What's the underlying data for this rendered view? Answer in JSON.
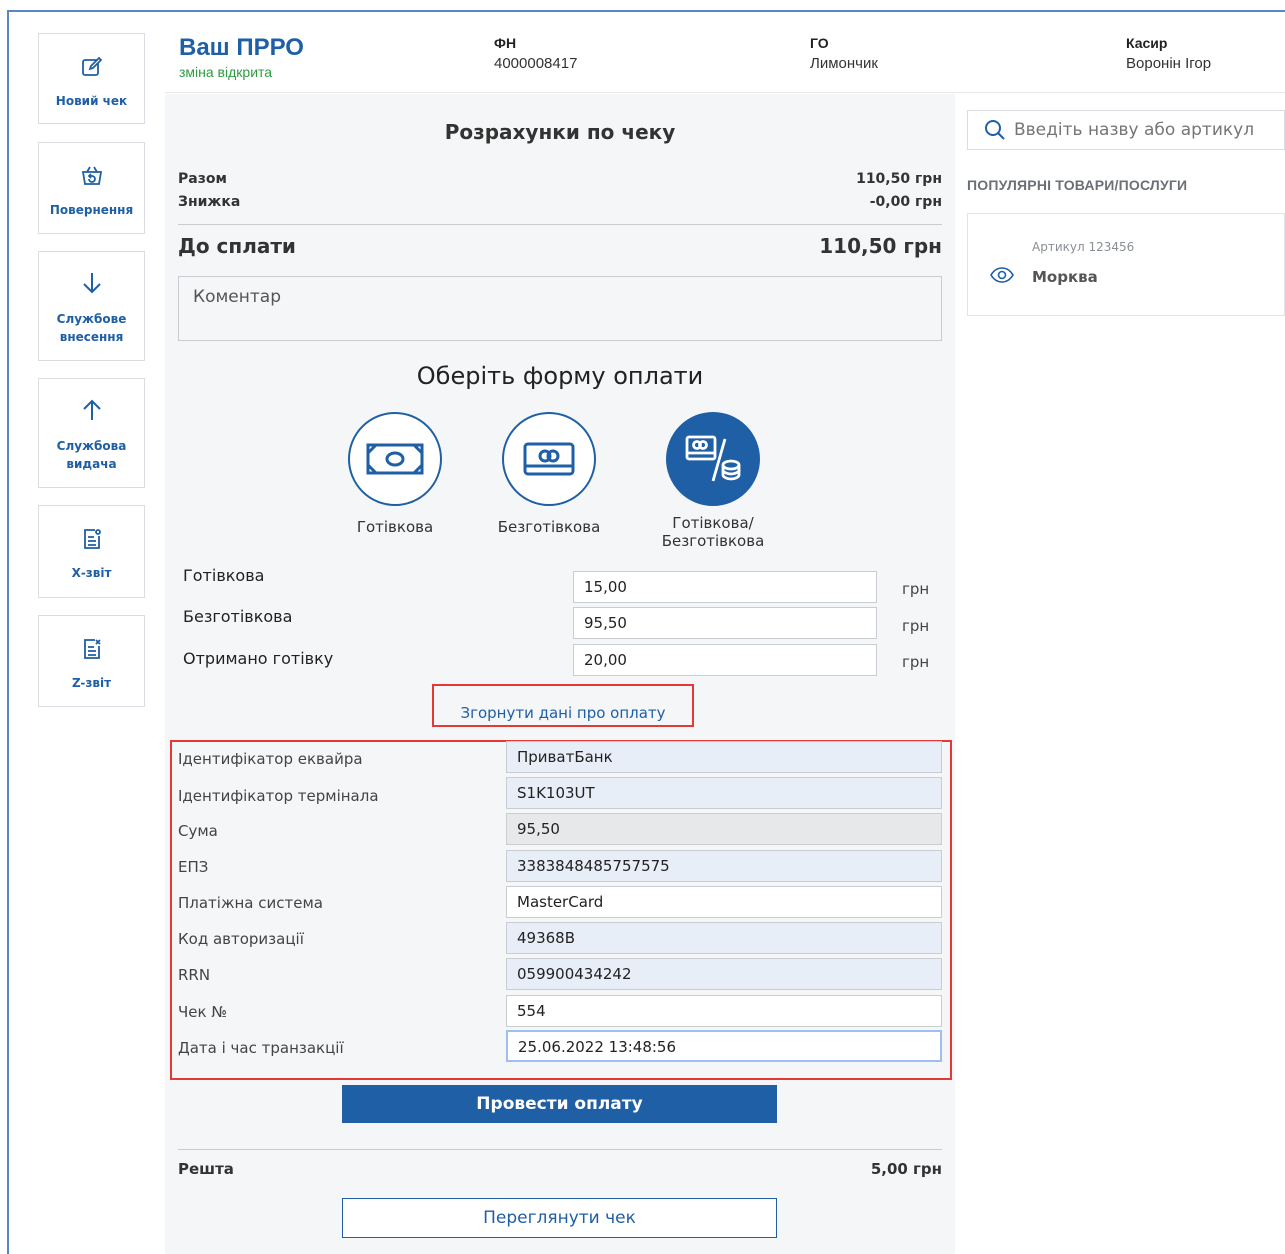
{
  "sidebar": {
    "items": [
      {
        "label": "Новий чек",
        "icon": "edit-icon"
      },
      {
        "label": "Повернення",
        "icon": "basket-return-icon"
      },
      {
        "label": "Службове внесення",
        "icon": "arrow-down-icon"
      },
      {
        "label": "Службова видача",
        "icon": "arrow-up-icon"
      },
      {
        "label": "Х-звіт",
        "icon": "x-report-icon"
      },
      {
        "label": "Z-звіт",
        "icon": "z-report-icon"
      }
    ]
  },
  "header": {
    "title": "Ваш ПРРО",
    "status": "зміна відкрита",
    "fn_label": "ФН",
    "fn_value": "4000008417",
    "go_label": "ГО",
    "go_value": "Лимончик",
    "cashier_label": "Касир",
    "cashier_value": "Воронін Ігор"
  },
  "main": {
    "title": "Розрахунки по чеку",
    "total_label": "Разом",
    "total_value": "110,50 грн",
    "discount_label": "Знижка",
    "discount_value": "-0,00 грн",
    "due_label": "До сплати",
    "due_value": "110,50 грн",
    "comment_placeholder": "Коментар",
    "payment_title": "Оберіть форму оплати",
    "methods": [
      {
        "label": "Готівкова",
        "icon": "cash-icon"
      },
      {
        "label": "Безготівкова",
        "icon": "card-icon"
      },
      {
        "label1": "Готівкова/",
        "label2": "Безготівкова",
        "icon": "card-coins-icon"
      }
    ],
    "amounts": [
      {
        "label": "Готівкова",
        "value": "15,00",
        "unit": "грн"
      },
      {
        "label": "Безготівкова",
        "value": "95,50",
        "unit": "грн"
      },
      {
        "label": "Отримано готівку",
        "value": "20,00",
        "unit": "грн"
      }
    ],
    "collapse_link": "Згорнути дані про оплату",
    "details": [
      {
        "label": "Ідентифікатор еквайра",
        "value": "ПриватБанк"
      },
      {
        "label": "Ідентифікатор термінала",
        "value": "S1K103UT"
      },
      {
        "label": "Сума",
        "value": "95,50"
      },
      {
        "label": "ЕПЗ",
        "value": "3383848485757575"
      },
      {
        "label": "Платіжна система",
        "value": "MasterCard"
      },
      {
        "label": "Код авторизації",
        "value": "49368B"
      },
      {
        "label": "RRN",
        "value": "059900434242"
      },
      {
        "label": "Чек №",
        "value": "554"
      },
      {
        "label": "Дата і час транзакції",
        "value": "25.06.2022 13:48:56"
      }
    ],
    "submit_button": "Провести оплату",
    "change_label": "Решта",
    "change_value": "5,00 грн",
    "view_button": "Переглянути чек"
  },
  "right": {
    "search_placeholder": "Введіть назву або артикул",
    "popular_title": "ПОПУЛЯРНІ ТОВАРИ/ПОСЛУГИ",
    "products": [
      {
        "article": "Артикул 123456",
        "name": "Морква"
      }
    ]
  },
  "colors": {
    "brand": "#1f5fa5",
    "status_open": "#2e9b3f",
    "highlight_border": "#e53935"
  }
}
